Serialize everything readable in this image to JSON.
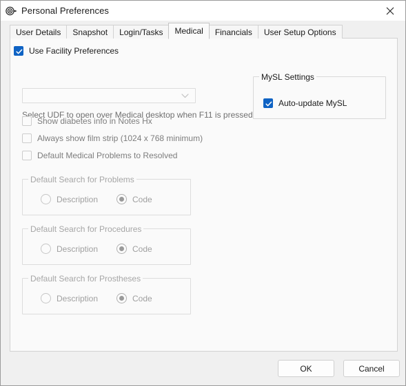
{
  "window": {
    "title": "Personal Preferences",
    "icon": "preferences-key-icon",
    "close_label": "✕"
  },
  "tabs": [
    {
      "label": "User Details",
      "active": false
    },
    {
      "label": "Snapshot",
      "active": false
    },
    {
      "label": "Login/Tasks",
      "active": false
    },
    {
      "label": "Medical",
      "active": true
    },
    {
      "label": "Financials",
      "active": false
    },
    {
      "label": "User Setup Options",
      "active": false
    }
  ],
  "medical": {
    "use_facility_preferences": {
      "label": "Use Facility Preferences",
      "checked": true,
      "enabled": true
    },
    "udf": {
      "label": "Select UDF to open over Medical desktop when F11 is pressed",
      "value": "",
      "placeholder": "",
      "chevron": "chevron-down-icon"
    },
    "checkboxes": [
      {
        "label": "Show diabetes info in Notes Hx",
        "checked": false,
        "enabled": false
      },
      {
        "label": "Always show film strip (1024 x 768 minimum)",
        "checked": false,
        "enabled": false
      },
      {
        "label": "Default Medical Problems to Resolved",
        "checked": false,
        "enabled": false
      }
    ],
    "mysl_group": {
      "title": "MySL Settings",
      "enabled": true,
      "auto_update": {
        "label": "Auto-update MySL",
        "checked": true
      }
    },
    "search_groups": [
      {
        "title": "Default Search for Problems",
        "enabled": false,
        "options": [
          {
            "label": "Description",
            "selected": false
          },
          {
            "label": "Code",
            "selected": true
          }
        ]
      },
      {
        "title": "Default Search for Procedures",
        "enabled": false,
        "options": [
          {
            "label": "Description",
            "selected": false
          },
          {
            "label": "Code",
            "selected": true
          }
        ]
      },
      {
        "title": "Default Search for Prostheses",
        "enabled": false,
        "options": [
          {
            "label": "Description",
            "selected": false
          },
          {
            "label": "Code",
            "selected": true
          }
        ]
      }
    ]
  },
  "footer": {
    "ok_label": "OK",
    "cancel_label": "Cancel"
  },
  "colors": {
    "accent": "#0f63c4",
    "titlebar_bg": "#ffffff",
    "window_bg": "#f0f0f0",
    "panel_bg": "#fafafa",
    "disabled_text": "#a0a0a0"
  }
}
